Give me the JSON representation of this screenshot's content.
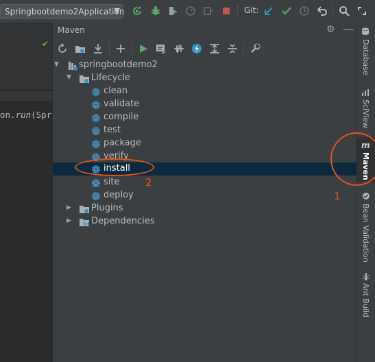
{
  "toolbar": {
    "run_config": "Springbootdemo2Application",
    "git_label": "Git:"
  },
  "editor": {
    "code_prefix": "on.",
    "code_method": "run",
    "code_suffix": "(Spri"
  },
  "maven_panel": {
    "title": "Maven",
    "tree": {
      "project": "springbootdemo2",
      "lifecycle": {
        "label": "Lifecycle",
        "goals": [
          "clean",
          "validate",
          "compile",
          "test",
          "package",
          "verify",
          "install",
          "site",
          "deploy"
        ],
        "selected": "install"
      },
      "plugins": "Plugins",
      "dependencies": "Dependencies"
    }
  },
  "right_stripe": {
    "tabs": [
      "Database",
      "SciView",
      "Maven",
      "Bean Validation",
      "Ant Build"
    ],
    "active": "Maven"
  },
  "annotations": {
    "marker_1": "1",
    "marker_2": "2"
  },
  "colors": {
    "annotation": "#e2541d",
    "selection": "#0d293e",
    "run_green": "#59a869",
    "stop_red": "#c75450",
    "git_blue": "#3592c4"
  }
}
